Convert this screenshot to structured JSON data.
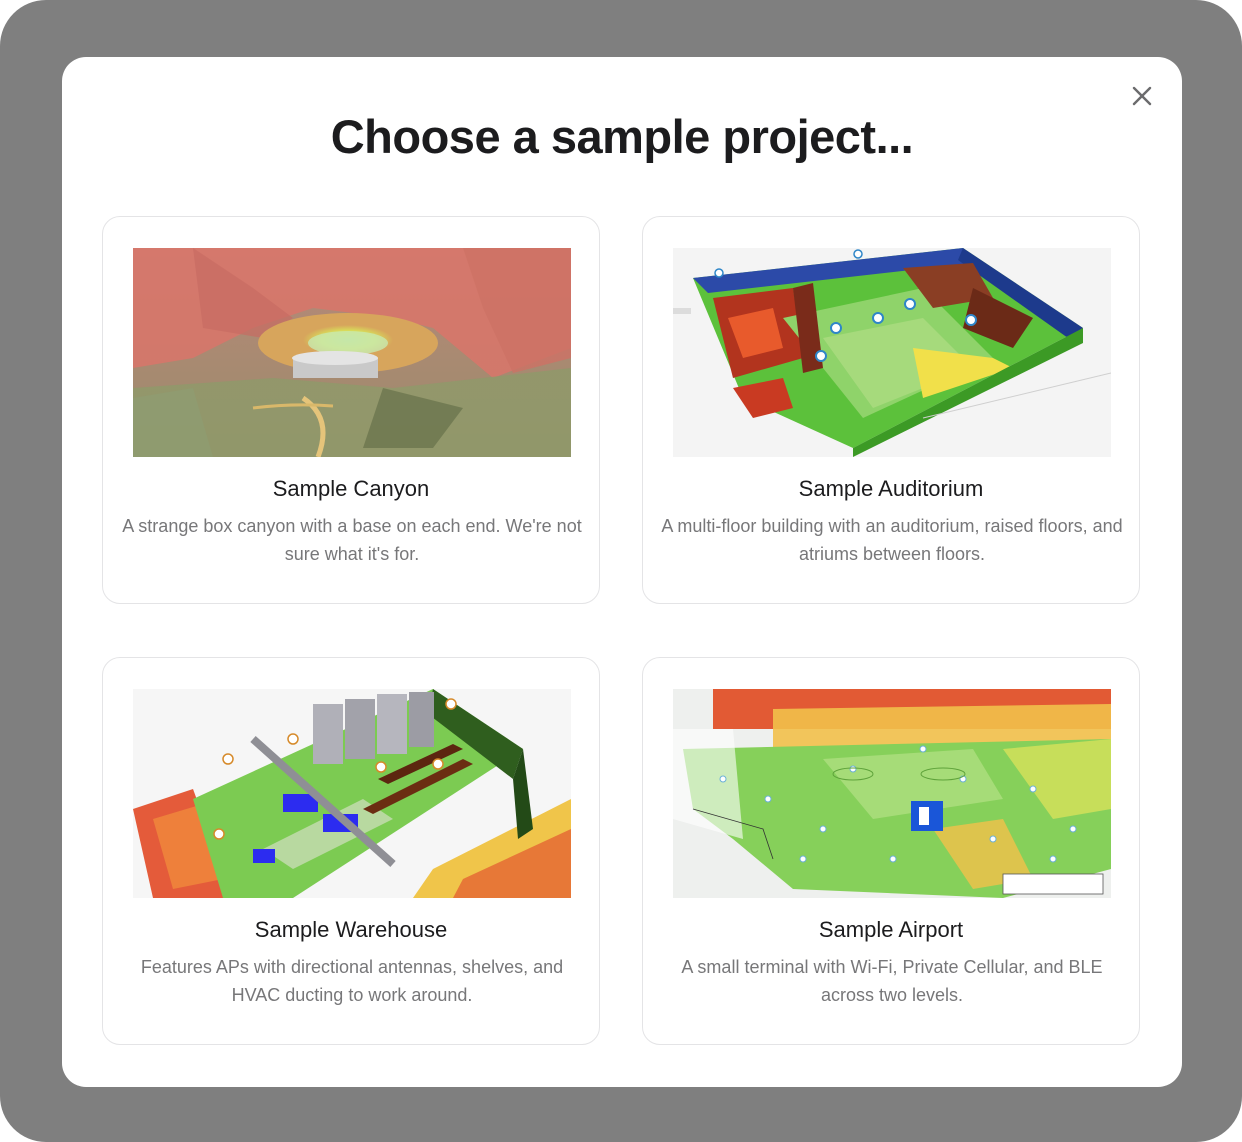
{
  "dialog": {
    "title": "Choose a sample project...",
    "close_icon": "close-icon"
  },
  "projects": [
    {
      "title": "Sample Canyon",
      "description": "A strange box canyon with a base on each end. We're not sure what it's for.",
      "thumbnail": "canyon-3d-heatmap"
    },
    {
      "title": "Sample Auditorium",
      "description": "A multi-floor building with an auditorium, raised floors, and atriums between floors.",
      "thumbnail": "auditorium-3d-heatmap"
    },
    {
      "title": "Sample Warehouse",
      "description": "Features APs with directional antennas, shelves, and HVAC ducting to work around.",
      "thumbnail": "warehouse-3d-heatmap"
    },
    {
      "title": "Sample Airport",
      "description": "A small terminal with Wi-Fi, Private Cellular, and BLE across two levels.",
      "thumbnail": "airport-floorplan-heatmap"
    }
  ],
  "colors": {
    "backdrop": "#7f7f7f",
    "title": "#1c1c1e",
    "description": "#777779",
    "card_border": "#e4e4e6"
  }
}
